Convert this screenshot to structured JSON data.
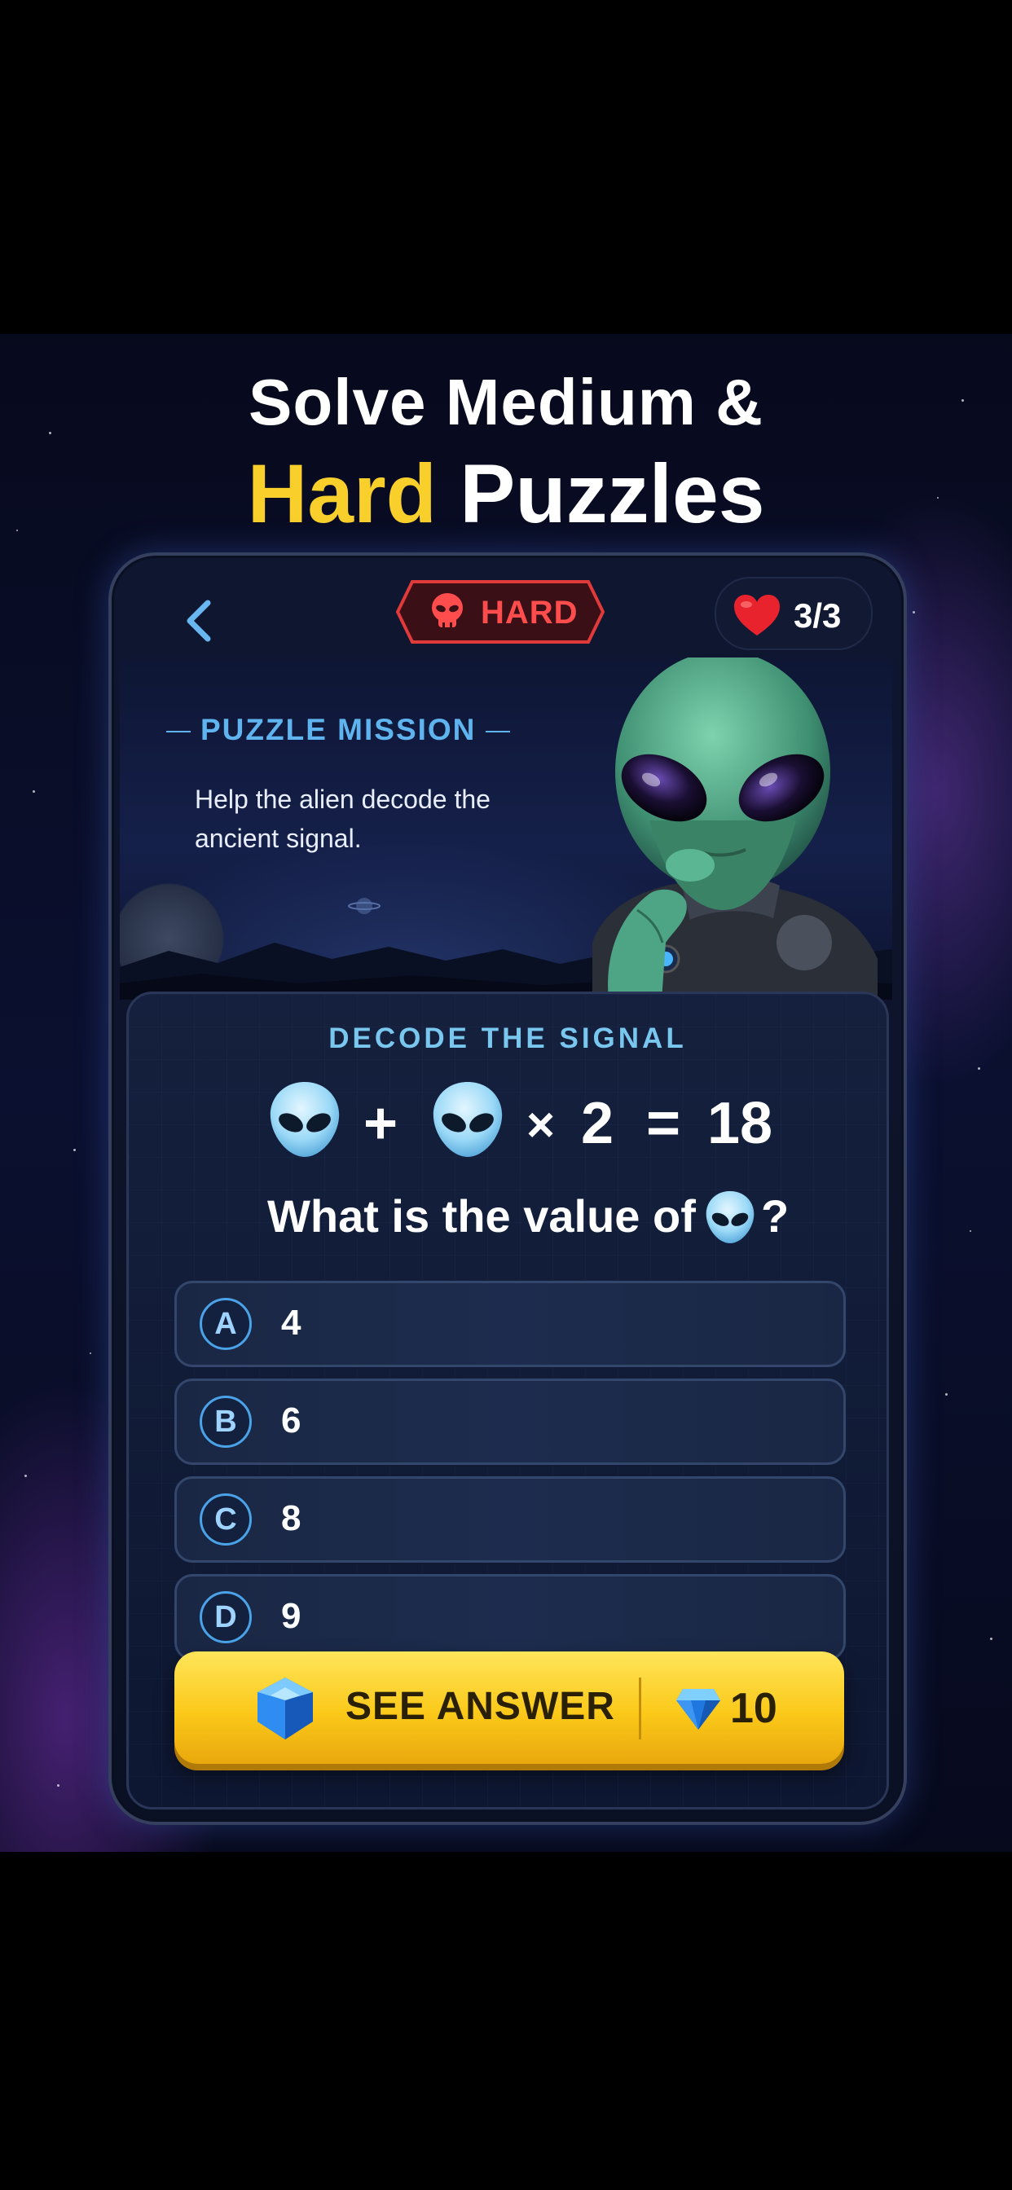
{
  "headline": {
    "line1": "Solve Medium &",
    "line2_accent": "Hard",
    "line2_rest": "Puzzles",
    "accent_color": "#f8cf2b"
  },
  "top_bar": {
    "back_icon": "chevron-left-icon",
    "difficulty_label": "HARD",
    "difficulty_icon": "alien-skull-icon",
    "lives": "3/3",
    "lives_icon": "heart-icon"
  },
  "mission": {
    "title": "PUZZLE MISSION",
    "description": "Help the alien decode the ancient signal."
  },
  "puzzle": {
    "title": "DECODE THE SIGNAL",
    "equation": {
      "symbol_icon": "alien-head-icon",
      "plus": "+",
      "times": "×",
      "multiplier": "2",
      "equals": "=",
      "result": "18"
    },
    "question": "What is the value of",
    "question_suffix": "?",
    "options": [
      {
        "letter": "A",
        "value": "4"
      },
      {
        "letter": "B",
        "value": "6"
      },
      {
        "letter": "C",
        "value": "8"
      },
      {
        "letter": "D",
        "value": "9"
      }
    ]
  },
  "see_answer": {
    "label": "SEE ANSWER",
    "cost": "10",
    "gem_icon": "blue-gem-icon"
  },
  "colors": {
    "hard_badge": "#ff4d4d",
    "mission_title": "#5fb4ef",
    "button_yellow": "#fbc919"
  }
}
